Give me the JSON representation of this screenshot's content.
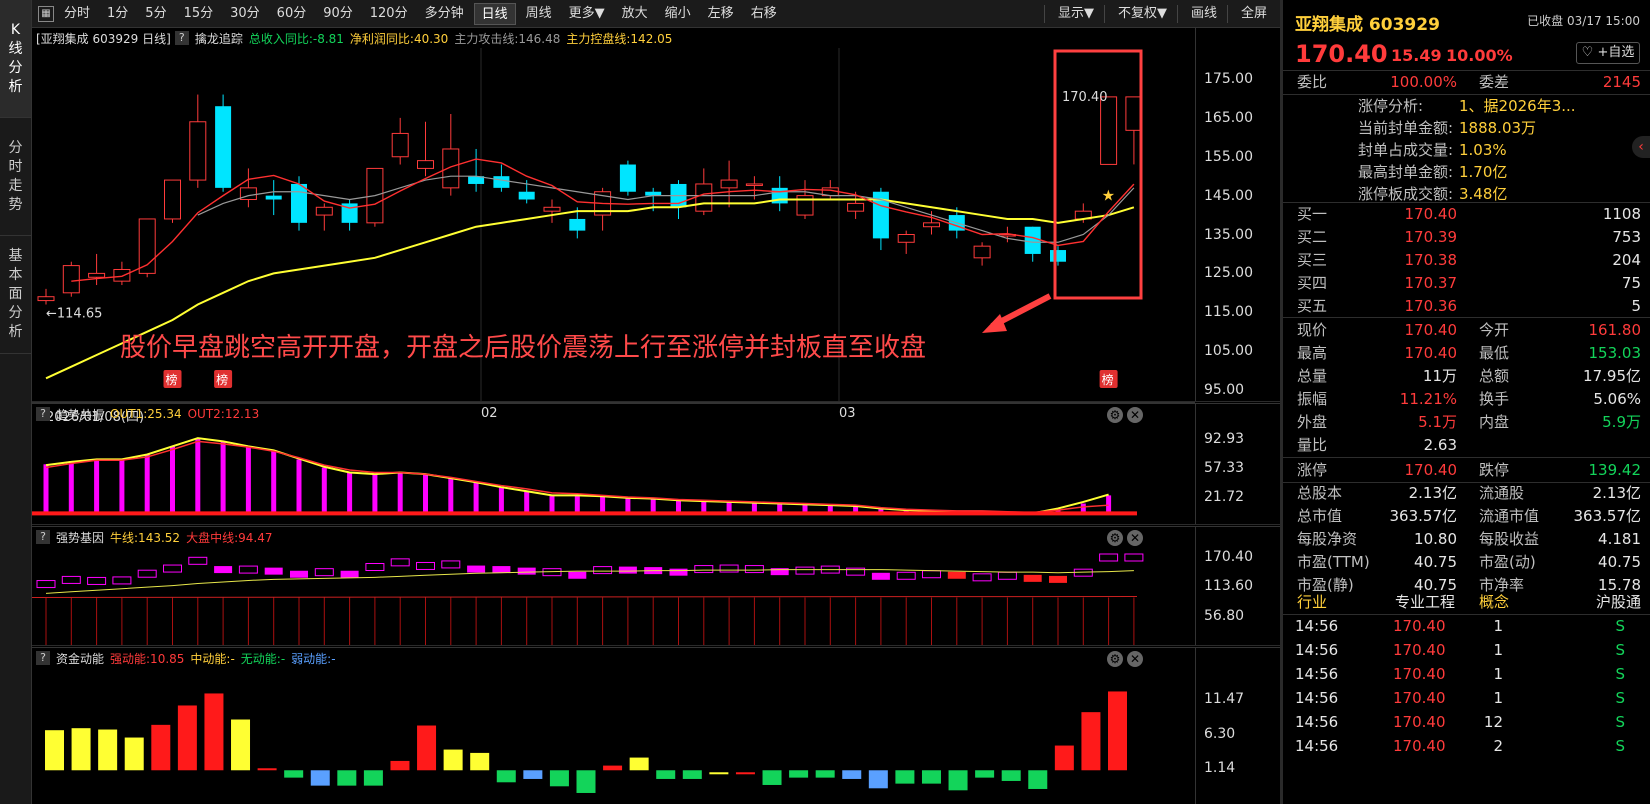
{
  "nav": {
    "kline": "K线分析",
    "fenshi": "分时走势",
    "jiben": "基本面分析"
  },
  "toolbar": {
    "items": [
      "分时",
      "1分",
      "5分",
      "15分",
      "30分",
      "60分",
      "90分",
      "120分",
      "多分钟",
      "日线",
      "周线",
      "更多▼",
      "放大",
      "缩小",
      "左移",
      "右移"
    ],
    "active": "日线",
    "display": "显示▼",
    "fuquan": "不复权▼",
    "draw": "画线",
    "full": "全屏"
  },
  "main": {
    "header": {
      "title": "[亚翔集成 603929 日线]",
      "ind": "擒龙追踪",
      "s1": "总收入同比:-8.81",
      "s2": "净利润同比:40.30",
      "s3": "主力攻击线:146.48",
      "s4": "主力控盘线:142.05"
    },
    "yticks": [
      "175.00",
      "165.00",
      "155.00",
      "145.00",
      "135.00",
      "125.00",
      "115.00",
      "105.00",
      "95.00"
    ],
    "low_label": "←114.65",
    "high_label": "170.40",
    "badge": "榜",
    "annotation": "股价早盘跳空高开开盘，开盘之后股价震荡上行至涨停并封板直至收盘",
    "dates": [
      "2026/01/08(四)",
      "02",
      "03"
    ]
  },
  "chart_data": {
    "type": "candlestick",
    "candles": [
      [
        118,
        121,
        117,
        119
      ],
      [
        120,
        128,
        119,
        127
      ],
      [
        124,
        130,
        122,
        125
      ],
      [
        123,
        128,
        122,
        126
      ],
      [
        125,
        139,
        124,
        139
      ],
      [
        139,
        149,
        138,
        149
      ],
      [
        149,
        171,
        147,
        164
      ],
      [
        168,
        171,
        146,
        147
      ],
      [
        144,
        152,
        142,
        147
      ],
      [
        145,
        149,
        140,
        144
      ],
      [
        148,
        150,
        136,
        138
      ],
      [
        140,
        143,
        136,
        142
      ],
      [
        143,
        144,
        136,
        138
      ],
      [
        138,
        152,
        137,
        152
      ],
      [
        155,
        165,
        153,
        161
      ],
      [
        152,
        164,
        150,
        154
      ],
      [
        147,
        166,
        145,
        157
      ],
      [
        150,
        157,
        146,
        148
      ],
      [
        150,
        153,
        146,
        147
      ],
      [
        146,
        149,
        143,
        144
      ],
      [
        141,
        144,
        138,
        142
      ],
      [
        139,
        142,
        134,
        136
      ],
      [
        140,
        147,
        136,
        146
      ],
      [
        153,
        154,
        145,
        146
      ],
      [
        146,
        147,
        141,
        145
      ],
      [
        148,
        149,
        139,
        142
      ],
      [
        141,
        152,
        140,
        148
      ],
      [
        147,
        154,
        142,
        149
      ],
      [
        148,
        150,
        144,
        148
      ],
      [
        147,
        150,
        141,
        143
      ],
      [
        140,
        149,
        139,
        145
      ],
      [
        145,
        149,
        144,
        147
      ],
      [
        141,
        146,
        139,
        143
      ],
      [
        146,
        147,
        131,
        134
      ],
      [
        133,
        136,
        130,
        135
      ],
      [
        137,
        141,
        135,
        138
      ],
      [
        140,
        142,
        134,
        136
      ],
      [
        129,
        133,
        127,
        132
      ],
      [
        135,
        137,
        133,
        135
      ],
      [
        137,
        137,
        128,
        130
      ],
      [
        131,
        132,
        127,
        128
      ],
      [
        139,
        143,
        138,
        141
      ],
      [
        153.03,
        170.4,
        153.03,
        170.4
      ],
      [
        161.8,
        170.4,
        153.03,
        170.4
      ]
    ],
    "ma_yellow": [
      98,
      101,
      104,
      107,
      110,
      113,
      117,
      120,
      123,
      125,
      126,
      127,
      128,
      129,
      131,
      133,
      135,
      137,
      138,
      139,
      140,
      141,
      141,
      141,
      142,
      142,
      143,
      143,
      143,
      144,
      144,
      144,
      144,
      144,
      143,
      142,
      141,
      140,
      139,
      139,
      138,
      139,
      140,
      142
    ],
    "ma_gray": [
      null,
      null,
      null,
      null,
      null,
      null,
      140,
      143,
      145,
      146,
      146,
      145,
      144,
      145,
      147,
      149,
      150,
      150,
      149,
      148,
      147,
      146,
      145,
      144,
      145,
      145,
      145,
      145,
      145,
      146,
      146,
      145,
      145,
      144,
      142,
      140,
      138,
      136,
      134,
      133,
      133,
      135,
      140,
      147
    ],
    "ind1": {
      "name": "趋势共振",
      "out1": "OUT1:25.34",
      "out2": "OUT2:12.13",
      "yticks": [
        "92.93",
        "57.33",
        "21.72"
      ],
      "bars": [
        62,
        66,
        68,
        68,
        74,
        84,
        93,
        90,
        84,
        78,
        68,
        58,
        52,
        50,
        52,
        50,
        45,
        40,
        34,
        30,
        25,
        25,
        24,
        21,
        20,
        18,
        17,
        16,
        15,
        14,
        13,
        12,
        11,
        9,
        7,
        6,
        5,
        5,
        4,
        3,
        8,
        14,
        24
      ],
      "line1": [
        61,
        65,
        68,
        68,
        74,
        84,
        94,
        90,
        84,
        79,
        69,
        59,
        52,
        50,
        52,
        50,
        45,
        40,
        34,
        29,
        24,
        24,
        23,
        21,
        20,
        18,
        17,
        16,
        15,
        14,
        13,
        12,
        11,
        8,
        6,
        5,
        4,
        4,
        3,
        2,
        8,
        16,
        25
      ],
      "line2": [
        58,
        63,
        67,
        67,
        71,
        80,
        90,
        87,
        83,
        78,
        70,
        61,
        55,
        52,
        52,
        50,
        46,
        41,
        36,
        32,
        27,
        26,
        24,
        22,
        21,
        19,
        18,
        17,
        16,
        15,
        14,
        13,
        12,
        9,
        7,
        6,
        5,
        5,
        4,
        3,
        6,
        10,
        12
      ]
    },
    "ind2": {
      "name": "强势基因",
      "s1": "牛线:143.52",
      "s2": "大盘中线:94.47",
      "yticks": [
        "170.40",
        "113.60",
        "56.80"
      ]
    },
    "ind3": {
      "name": "资金动能",
      "s1": "强动能:10.85",
      "s2": "中动能:-",
      "s3": "无动能:-",
      "s4": "弱动能:-",
      "yticks": [
        "11.47",
        "6.30",
        "1.14"
      ],
      "bars": [
        6.8,
        7.1,
        6.9,
        5.7,
        7.6,
        10.5,
        12.3,
        8.4,
        1.1,
        -0.3,
        -1.5,
        -1.5,
        -1.5,
        2.2,
        7.5,
        3.9,
        3.4,
        -1.0,
        -0.5,
        -1.6,
        -2.6,
        1.5,
        2.7,
        -0.5,
        -0.5,
        0.5,
        0.5,
        -1.4,
        -0.3,
        -0.3,
        -0.5,
        -1.9,
        -1.2,
        -1.2,
        -2.2,
        -0.3,
        -0.8,
        -2.0,
        4.5,
        9.5,
        12.6
      ]
    }
  },
  "right": {
    "name": "亚翔集成",
    "code": "603929",
    "status": "已收盘",
    "date": "03/17 15:00",
    "price": "170.40",
    "chg": "15.49",
    "pct": "10.00%",
    "fav": "♡ +自选",
    "webi_l": "委比",
    "webi": "100.00%",
    "wc_l": "委差",
    "wc": "2145",
    "zt": [
      {
        "l": "涨停分析:",
        "v": "1、据2026年3..."
      },
      {
        "l": "当前封单金额:",
        "v": "1888.03万"
      },
      {
        "l": "封单占成交量:",
        "v": "1.03%"
      },
      {
        "l": "最高封单金额:",
        "v": "1.70亿"
      },
      {
        "l": "涨停板成交额:",
        "v": "3.48亿"
      }
    ],
    "buy": [
      {
        "l": "买一",
        "p": "170.40",
        "v": "1108"
      },
      {
        "l": "买二",
        "p": "170.39",
        "v": "753"
      },
      {
        "l": "买三",
        "p": "170.38",
        "v": "204"
      },
      {
        "l": "买四",
        "p": "170.37",
        "v": "75"
      },
      {
        "l": "买五",
        "p": "170.36",
        "v": "5"
      }
    ],
    "stats": [
      {
        "l1": "现价",
        "v1": "170.40",
        "c1": "c-red",
        "l2": "今开",
        "v2": "161.80",
        "c2": "c-red"
      },
      {
        "l1": "最高",
        "v1": "170.40",
        "c1": "c-red",
        "l2": "最低",
        "v2": "153.03",
        "c2": "c-grn"
      },
      {
        "l1": "总量",
        "v1": "11万",
        "c1": "c-wht",
        "l2": "总额",
        "v2": "17.95亿",
        "c2": "c-wht"
      },
      {
        "l1": "振幅",
        "v1": "11.21%",
        "c1": "c-red",
        "l2": "换手",
        "v2": "5.06%",
        "c2": "c-wht"
      },
      {
        "l1": "外盘",
        "v1": "5.1万",
        "c1": "c-red",
        "l2": "内盘",
        "v2": "5.9万",
        "c2": "c-grn"
      },
      {
        "l1": "量比",
        "v1": "2.63",
        "c1": "c-wht",
        "l2": "",
        "v2": "",
        "c2": "c-wht"
      },
      {
        "l1": "涨停",
        "v1": "170.40",
        "c1": "c-red",
        "l2": "跌停",
        "v2": "139.42",
        "c2": "c-grn"
      },
      {
        "l1": "总股本",
        "v1": "2.13亿",
        "c1": "c-wht",
        "l2": "流通股",
        "v2": "2.13亿",
        "c2": "c-wht"
      },
      {
        "l1": "总市值",
        "v1": "363.57亿",
        "c1": "c-wht",
        "l2": "流通市值",
        "v2": "363.57亿",
        "c2": "c-wht"
      },
      {
        "l1": "每股净资",
        "v1": "10.80",
        "c1": "c-wht",
        "l2": "每股收益",
        "v2": "4.181",
        "c2": "c-wht"
      },
      {
        "l1": "市盈(TTM)",
        "v1": "40.75",
        "c1": "c-wht",
        "l2": "市盈(动)",
        "v2": "40.75",
        "c2": "c-wht"
      },
      {
        "l1": "市盈(静)",
        "v1": "40.75",
        "c1": "c-wht",
        "l2": "市净率",
        "v2": "15.78",
        "c2": "c-wht"
      }
    ],
    "tags": [
      "行业",
      "专业工程",
      "概念",
      "沪股通"
    ],
    "ticks": [
      {
        "t": "14:56",
        "p": "170.40",
        "v": "1",
        "s": "S"
      },
      {
        "t": "14:56",
        "p": "170.40",
        "v": "1",
        "s": "S"
      },
      {
        "t": "14:56",
        "p": "170.40",
        "v": "1",
        "s": "S"
      },
      {
        "t": "14:56",
        "p": "170.40",
        "v": "1",
        "s": "S"
      },
      {
        "t": "14:56",
        "p": "170.40",
        "v": "12",
        "s": "S"
      },
      {
        "t": "14:56",
        "p": "170.40",
        "v": "2",
        "s": "S"
      }
    ]
  }
}
